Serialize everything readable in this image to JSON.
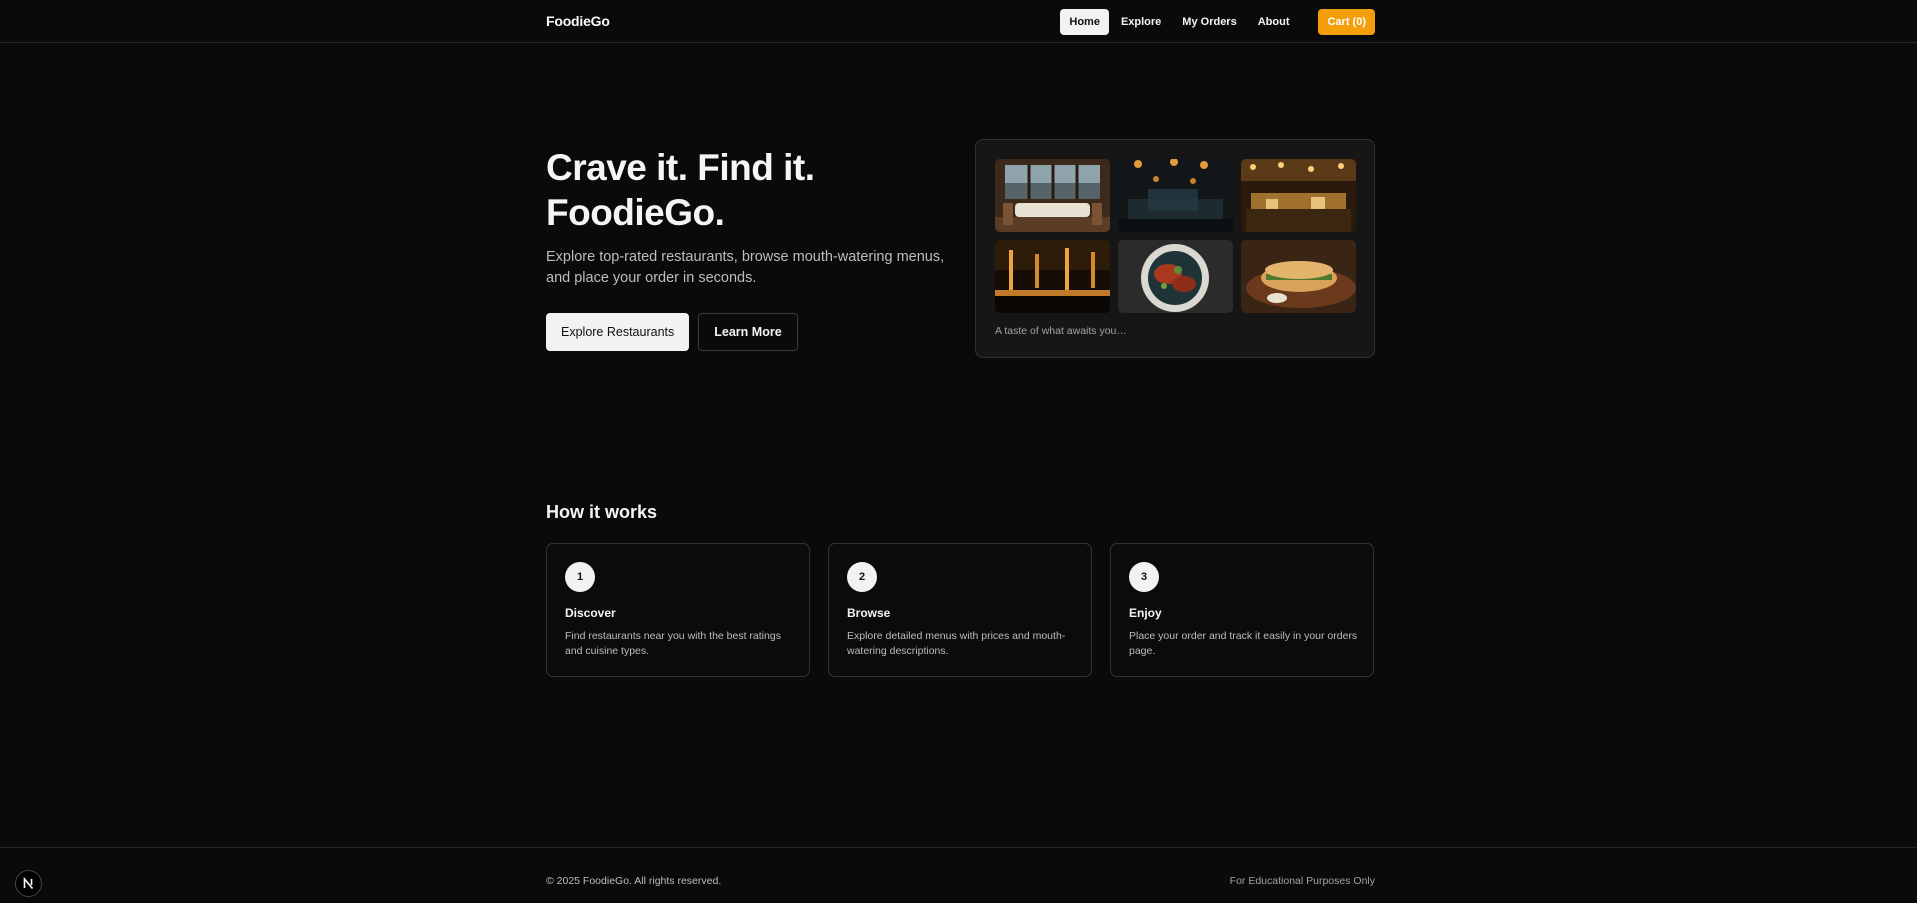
{
  "header": {
    "brand": "FoodieGo",
    "nav": [
      {
        "label": "Home",
        "active": true
      },
      {
        "label": "Explore",
        "active": false
      },
      {
        "label": "My Orders",
        "active": false
      },
      {
        "label": "About",
        "active": false
      }
    ],
    "cart_label": "Cart (0)",
    "accent_color": "#f59e0b"
  },
  "hero": {
    "title_line1": "Crave it. Find it.",
    "title_line2": "FoodieGo.",
    "subtitle": "Explore top-rated restaurants, browse mouth-watering menus, and place your order in seconds.",
    "primary_button": "Explore Restaurants",
    "secondary_button": "Learn More"
  },
  "gallery": {
    "caption": "A taste of what awaits you…",
    "images": [
      "restaurant-window-view",
      "dim-dining-room-lanterns",
      "restaurant-warm-lights",
      "bar-interior-night",
      "plated-dish-topdown",
      "sandwich-platter"
    ]
  },
  "how_it_works": {
    "title": "How it works",
    "steps": [
      {
        "number": "1",
        "title": "Discover",
        "description": "Find restaurants near you with the best ratings and cuisine types."
      },
      {
        "number": "2",
        "title": "Browse",
        "description": "Explore detailed menus with prices and mouth-watering descriptions."
      },
      {
        "number": "3",
        "title": "Enjoy",
        "description": "Place your order and track it easily in your orders page."
      }
    ]
  },
  "footer": {
    "copyright": "© 2025 FoodieGo. All rights reserved.",
    "note": "For Educational Purposes Only"
  },
  "dev_badge": {
    "letter": "N"
  }
}
